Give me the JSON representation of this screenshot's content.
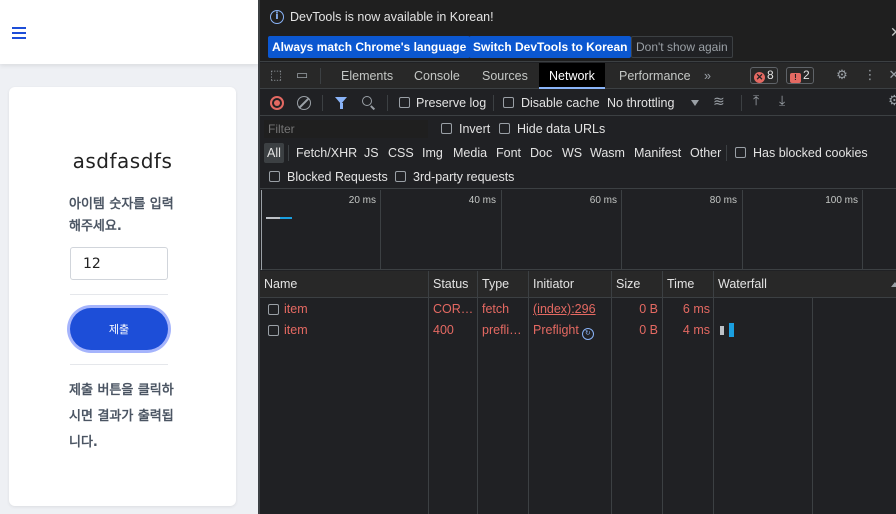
{
  "page": {
    "title": "asdfasdfs",
    "instruction": "아이템 숫자를 입력해주세요.",
    "input_value": "12",
    "submit_label": "제출",
    "result_text": "제출 버튼을 클릭하시면 결과가 출력됩니다.",
    "accent": "#1d4ed8"
  },
  "devtools": {
    "infobar": {
      "message": "DevTools is now available in Korean!",
      "btn_match": "Always match Chrome's language",
      "btn_switch": "Switch DevTools to Korean",
      "btn_dismiss": "Don't show again"
    },
    "tabs": [
      "Elements",
      "Console",
      "Sources",
      "Network",
      "Performance"
    ],
    "active_tab": "Network",
    "more_tabs": "»",
    "errors_count": "8",
    "issues_count": "2",
    "toolbar": {
      "preserve_log": "Preserve log",
      "disable_cache": "Disable cache",
      "throttling": "No throttling"
    },
    "filter": {
      "placeholder": "Filter",
      "invert": "Invert",
      "hide_data_urls": "Hide data URLs"
    },
    "types": [
      "All",
      "Fetch/XHR",
      "JS",
      "CSS",
      "Img",
      "Media",
      "Font",
      "Doc",
      "WS",
      "Wasm",
      "Manifest",
      "Other"
    ],
    "blocked_cookies": "Has blocked cookies",
    "blocked_requests": "Blocked Requests",
    "third_party": "3rd-party requests",
    "overview_ticks": [
      "20 ms",
      "40 ms",
      "60 ms",
      "80 ms",
      "100 ms"
    ],
    "columns": [
      "Name",
      "Status",
      "Type",
      "Initiator",
      "Size",
      "Time",
      "Waterfall"
    ],
    "requests": [
      {
        "name": "item",
        "status": "COR…",
        "type": "fetch",
        "initiator": "(index):296",
        "size": "0 B",
        "time": "6 ms"
      },
      {
        "name": "item",
        "status": "400",
        "type": "prefli…",
        "initiator": "Preflight",
        "size": "0 B",
        "time": "4 ms"
      }
    ],
    "colors": {
      "error": "#e46962",
      "link": "#8ab4f8",
      "background": "#202124"
    }
  }
}
